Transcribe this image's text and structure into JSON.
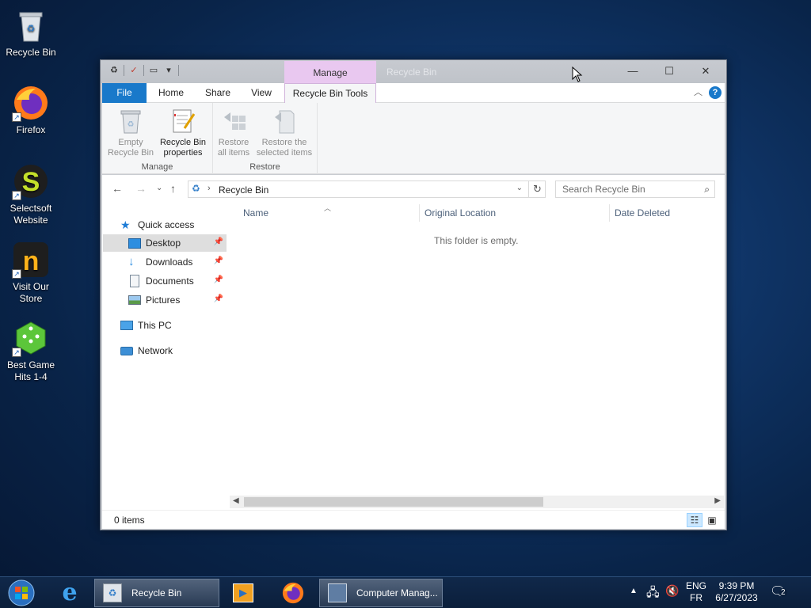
{
  "desktop": {
    "icons": [
      {
        "label": "Recycle Bin"
      },
      {
        "label": "Firefox"
      },
      {
        "label": "Selectsoft Website"
      },
      {
        "label": "Visit Our Store"
      },
      {
        "label": "Best Game Hits 1-4"
      }
    ]
  },
  "window": {
    "title": "Recycle Bin",
    "contextual_tab": "Manage",
    "ribbon_tabs": [
      "File",
      "Home",
      "Share",
      "View",
      "Recycle Bin Tools"
    ],
    "ribbon": {
      "manage_group": {
        "label": "Manage",
        "empty_line1": "Empty",
        "empty_line2": "Recycle Bin",
        "props_line1": "Recycle Bin",
        "props_line2": "properties"
      },
      "restore_group": {
        "label": "Restore",
        "restore_all_line1": "Restore",
        "restore_all_line2": "all items",
        "restore_sel_line1": "Restore the",
        "restore_sel_line2": "selected items"
      }
    },
    "address": {
      "path": "Recycle Bin",
      "search_placeholder": "Search Recycle Bin"
    },
    "nav_pane": {
      "quick_access": "Quick access",
      "items": [
        "Desktop",
        "Downloads",
        "Documents",
        "Pictures"
      ],
      "this_pc": "This PC",
      "network": "Network"
    },
    "columns": [
      "Name",
      "Original Location",
      "Date Deleted"
    ],
    "empty_message": "This folder is empty.",
    "status": "0 items"
  },
  "taskbar": {
    "tasks": [
      {
        "label": "Recycle Bin"
      },
      {
        "label": "Computer Manag..."
      }
    ],
    "lang_line1": "ENG",
    "lang_line2": "FR",
    "time": "9:39 PM",
    "date": "6/27/2023",
    "notifications": "2"
  },
  "colors": {
    "accent": "#1979ca",
    "manage_tab": "#e9c8f0",
    "selection": "#dedede"
  }
}
